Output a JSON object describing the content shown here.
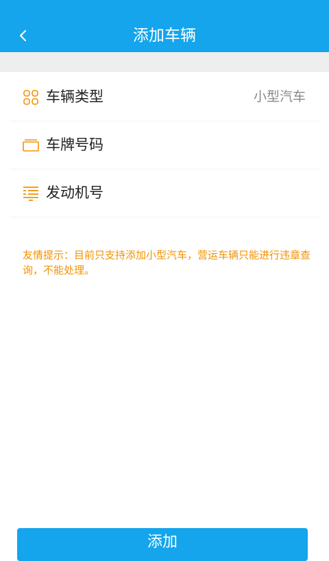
{
  "header": {
    "title": "添加车辆",
    "back_icon": "chevron-left-icon"
  },
  "rows": [
    {
      "label": "车辆类型",
      "value": "小型汽车",
      "icon": "grid-icon"
    },
    {
      "label": "车牌号码",
      "value": "",
      "icon": "card-icon"
    },
    {
      "label": "发动机号",
      "value": "",
      "icon": "engine-icon"
    }
  ],
  "tip": "友情提示：目前只支持添加小型汽车，营运车辆只能进行违章查询，不能处理。",
  "add_button": "添加",
  "colors": {
    "primary": "#14a5ec",
    "accent": "#f39200",
    "value_text": "#888888"
  }
}
